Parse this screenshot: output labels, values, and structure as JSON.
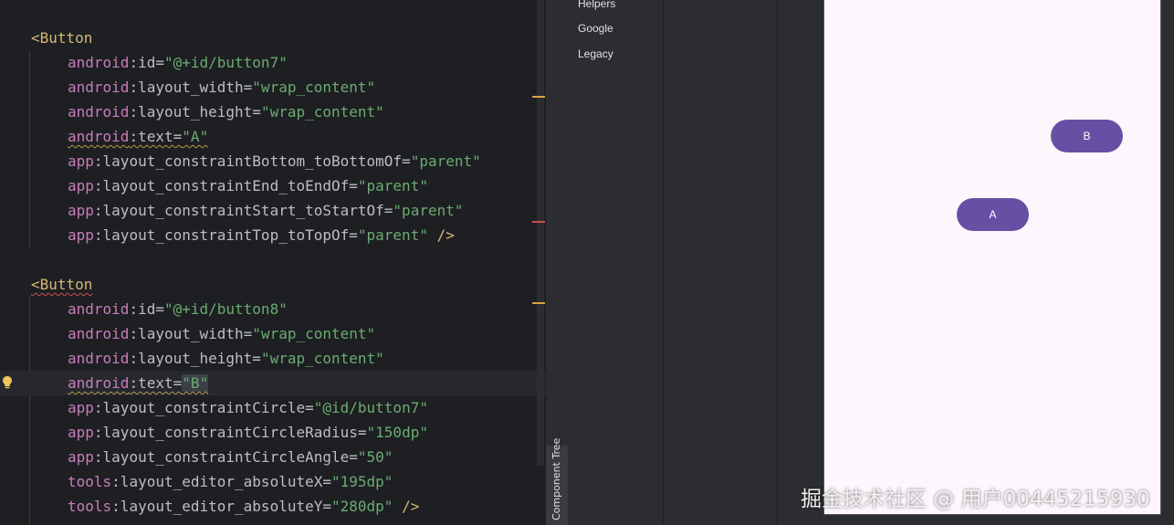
{
  "editor": {
    "block1": {
      "tag": "<Button",
      "lines": [
        {
          "ns": "android",
          "attr": ":id=",
          "val": "\"@+id/button7\""
        },
        {
          "ns": "android",
          "attr": ":layout_width=",
          "val": "\"wrap_content\""
        },
        {
          "ns": "android",
          "attr": ":layout_height=",
          "val": "\"wrap_content\""
        },
        {
          "ns": "android",
          "attr": ":text=",
          "val": "\"A\""
        },
        {
          "ns": "app",
          "attr": ":layout_constraintBottom_toBottomOf=",
          "val": "\"parent\""
        },
        {
          "ns": "app",
          "attr": ":layout_constraintEnd_toEndOf=",
          "val": "\"parent\""
        },
        {
          "ns": "app",
          "attr": ":layout_constraintStart_toStartOf=",
          "val": "\"parent\""
        },
        {
          "ns": "app",
          "attr": ":layout_constraintTop_toTopOf=",
          "val": "\"parent\"",
          "end": " />"
        }
      ]
    },
    "block2": {
      "tag": "<Button",
      "lines": [
        {
          "ns": "android",
          "attr": ":id=",
          "val": "\"@+id/button8\""
        },
        {
          "ns": "android",
          "attr": ":layout_width=",
          "val": "\"wrap_content\""
        },
        {
          "ns": "android",
          "attr": ":layout_height=",
          "val": "\"wrap_content\""
        },
        {
          "ns": "android",
          "attr": ":text=",
          "val": "\"B\""
        },
        {
          "ns": "app",
          "attr": ":layout_constraintCircle=",
          "val": "\"@id/button7\""
        },
        {
          "ns": "app",
          "attr": ":layout_constraintCircleRadius=",
          "val": "\"150dp\""
        },
        {
          "ns": "app",
          "attr": ":layout_constraintCircleAngle=",
          "val": "\"50\""
        },
        {
          "ns": "tools",
          "attr": ":layout_editor_absoluteX=",
          "val": "\"195dp\""
        },
        {
          "ns": "tools",
          "attr": ":layout_editor_absoluteY=",
          "val": "\"280dp\"",
          "end": " />"
        }
      ]
    }
  },
  "side_tab": {
    "label": "Component Tree"
  },
  "palette": {
    "items": [
      "Helpers",
      "Google",
      "Legacy"
    ]
  },
  "preview": {
    "button_a": "A",
    "button_b": "B"
  },
  "watermark": "掘金技术社区 @ 用户00445215930",
  "colors": {
    "tag": "#d5b778",
    "namespace": "#c77dbb",
    "value": "#6aab73",
    "button": "#6750a4"
  }
}
